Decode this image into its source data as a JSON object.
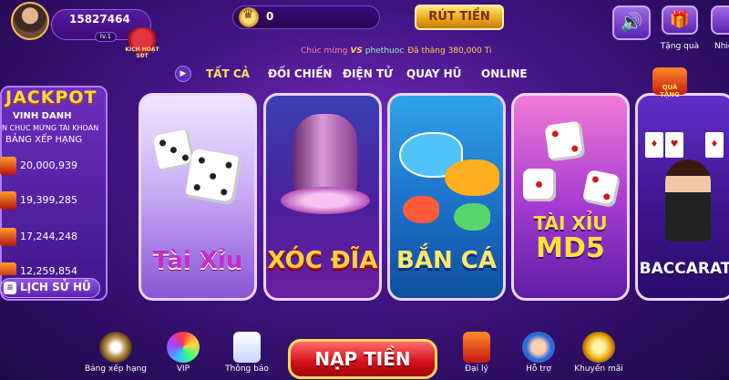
{
  "header": {
    "user_id": "15827464",
    "level": "lv.1",
    "activation_badge": "KÍCH HOẠT SĐT",
    "coins": "0",
    "withdraw_label": "RÚT TIỀN",
    "gift_label": "Tặng quà",
    "more_label": "Nhiề"
  },
  "marquee": {
    "prefix": "Chúc mừng",
    "vs": "VS",
    "user": "phethuoc",
    "message": "Đã thắng 380,000 Ti"
  },
  "tabs": [
    "TẤT CẢ",
    "ĐỐI CHIẾN",
    "ĐIỆN TỬ",
    "QUAY HŨ",
    "ONLINE"
  ],
  "jackpot": {
    "title": "JACKPOT",
    "vinh_danh": "VINH DANH",
    "congrats": "N CHÚC MỪNG TÀI KHOẢN",
    "ranking": "BẢNG XẾP HẠNG",
    "values": [
      "20,000,939",
      "19,399,285",
      "17,244,248",
      "12,259,854"
    ],
    "history_label": "LỊCH SỬ HŨ"
  },
  "games": {
    "taixiu": "Tài Xỉu",
    "xocdia": "XÓC ĐĨA",
    "banca": "BẮN CÁ",
    "md5_line1": "TÀI XỈU",
    "md5_line2": "MD5",
    "baccarat": "BACCARAT",
    "gift_badge": "QUÀ TẶNG"
  },
  "bottom": {
    "ranking": "Bảng xếp hạng",
    "vip": "VIP",
    "notifications": "Thông báo",
    "deposit": "NẠP TIỀN",
    "agent": "Đại lý",
    "support": "Hỗ trợ",
    "promo": "Khuyến mãi"
  },
  "colors": {
    "accent_gold": "#ffd93b",
    "background": "#3f1480",
    "deposit_red": "#d3101a"
  }
}
